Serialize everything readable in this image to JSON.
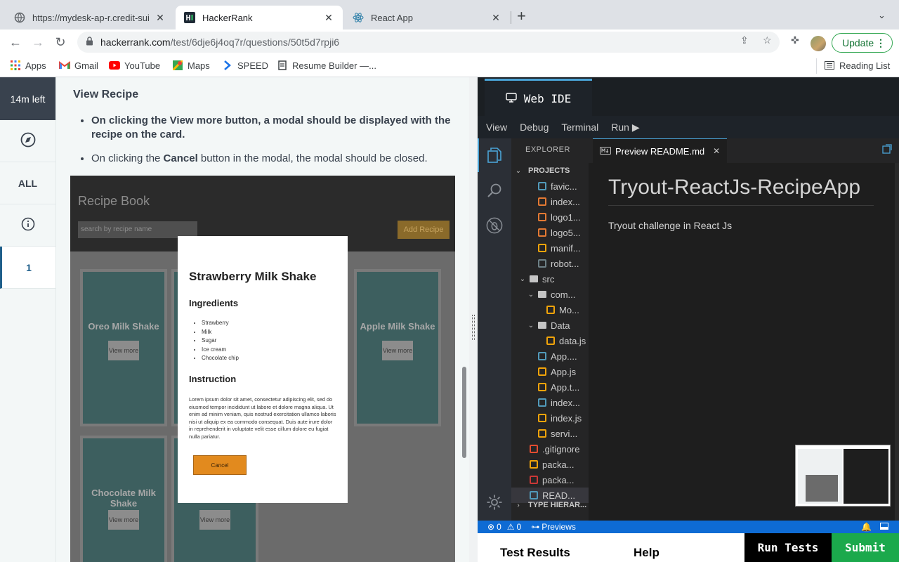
{
  "browser": {
    "tabs": [
      {
        "title": "https://mydesk-ap-r.credit-sui",
        "close": "✕"
      },
      {
        "title": "HackerRank",
        "close": "✕"
      },
      {
        "title": "React App",
        "close": "✕"
      }
    ],
    "url_host": "hackerrank.com",
    "url_path": "/test/6dje6j4oq7r/questions/50t5d7rpji6",
    "update_label": "Update",
    "bookmarks": [
      "Apps",
      "Gmail",
      "YouTube",
      "Maps",
      "SPEED",
      "Resume Builder —..."
    ],
    "reading_list": "Reading List"
  },
  "hr_nav": {
    "time_left": "14m left",
    "all_label": "ALL",
    "question_number": "1"
  },
  "question": {
    "heading": "View Recipe",
    "bullet1_bold": "On clicking the View more button, a modal should be displayed with the recipe on the card.",
    "bullet2_pre": "On clicking the ",
    "bullet2_bold": "Cancel",
    "bullet2_post": " button in the modal, the modal should be closed."
  },
  "recipe_screenshot": {
    "brand": "Recipe Book",
    "search_placeholder": "search by recipe name",
    "add_button": "Add Recipe",
    "cards": [
      {
        "title": "Oreo Milk Shake",
        "button": "View more"
      },
      {
        "title": "Apple Milk Shake",
        "button": "View more"
      },
      {
        "title": "Chocolate Milk Shake",
        "button": "View more"
      },
      {
        "title": "",
        "button": "View more"
      }
    ],
    "modal": {
      "title": "Strawberry Milk Shake",
      "ingredients_heading": "Ingredients",
      "ingredients": [
        "Strawberry",
        "Milk",
        "Sugar",
        "Ice cream",
        "Chocolate chip"
      ],
      "instruction_heading": "Instruction",
      "instruction_text": "Lorem ipsum dolor sit amet, consectetur adipiscing elit, sed do eiusmod tempor incididunt ut labore et dolore magna aliqua. Ut enim ad minim veniam, quis nostrud exercitation ullamco laboris nisi ut aliquip ex ea commodo consequat. Duis aute irure dolor in reprehenderit in voluptate velit esse cillum dolore eu fugiat nulla pariatur.",
      "cancel": "Cancel"
    }
  },
  "ide": {
    "tab_title": "Web IDE",
    "menu": [
      "View",
      "Debug",
      "Terminal",
      "Run ▶"
    ],
    "explorer_title": "EXPLORER",
    "projects_label": "PROJECTS",
    "files": [
      {
        "name": "favic...",
        "indent": 2,
        "kind": "file",
        "color": "#519aba"
      },
      {
        "name": "index...",
        "indent": 2,
        "kind": "file",
        "color": "#e37933"
      },
      {
        "name": "logo1...",
        "indent": 2,
        "kind": "file",
        "color": "#e37933"
      },
      {
        "name": "logo5...",
        "indent": 2,
        "kind": "file",
        "color": "#e37933"
      },
      {
        "name": "manif...",
        "indent": 2,
        "kind": "file",
        "color": "#f0a30a"
      },
      {
        "name": "robot...",
        "indent": 2,
        "kind": "file",
        "color": "#6d8086"
      },
      {
        "name": "src",
        "indent": 1,
        "kind": "folder",
        "color": "#c5c5c5"
      },
      {
        "name": "com...",
        "indent": 2,
        "kind": "folder",
        "color": "#c5c5c5"
      },
      {
        "name": "Mo...",
        "indent": 3,
        "kind": "file",
        "color": "#f0a30a"
      },
      {
        "name": "Data",
        "indent": 2,
        "kind": "folder",
        "color": "#c5c5c5"
      },
      {
        "name": "data.js",
        "indent": 3,
        "kind": "file",
        "color": "#f0a30a"
      },
      {
        "name": "App....",
        "indent": 2,
        "kind": "file",
        "color": "#519aba"
      },
      {
        "name": "App.js",
        "indent": 2,
        "kind": "file",
        "color": "#f0a30a"
      },
      {
        "name": "App.t...",
        "indent": 2,
        "kind": "file",
        "color": "#f0a30a"
      },
      {
        "name": "index...",
        "indent": 2,
        "kind": "file",
        "color": "#519aba"
      },
      {
        "name": "index.js",
        "indent": 2,
        "kind": "file",
        "color": "#f0a30a"
      },
      {
        "name": "servi...",
        "indent": 2,
        "kind": "file",
        "color": "#f0a30a"
      },
      {
        "name": ".gitignore",
        "indent": 1,
        "kind": "file",
        "color": "#e44c30"
      },
      {
        "name": "packa...",
        "indent": 1,
        "kind": "file",
        "color": "#f0a30a"
      },
      {
        "name": "packa...",
        "indent": 1,
        "kind": "file",
        "color": "#cb3837"
      },
      {
        "name": "READ...",
        "indent": 1,
        "kind": "file",
        "color": "#519aba",
        "selected": true
      }
    ],
    "type_hierarchy": "TYPE HIERAR...",
    "editor_tab": "Preview README.md",
    "readme_title": "Tryout-ReactJs-RecipeApp",
    "readme_body": "Tryout challenge in React Js",
    "status_errors": "0",
    "status_warnings": "0",
    "status_previews": "Previews",
    "bottom_tabs": [
      "Test Results",
      "Help"
    ],
    "run_tests": "Run Tests",
    "submit": "Submit"
  }
}
